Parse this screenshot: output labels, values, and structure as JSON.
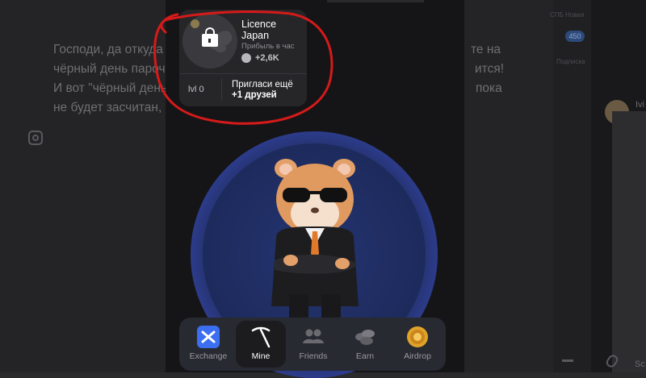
{
  "background_article": {
    "lines": [
      "Господи, да откуда и",
      "чёрный день парочк",
      "И вот \"чёрный день\"",
      "не будет засчитан, р"
    ],
    "right_fragments": [
      "те на",
      "ится!",
      "пока"
    ]
  },
  "right_sidebar": {
    "label_top": "СПБ Новая",
    "badge": "450",
    "label2": "Подписка",
    "label3": "Ivi",
    "label4": "Sc"
  },
  "card": {
    "title": "Licence Japan",
    "subtitle": "Прибыль в час",
    "profit": "+2,6K",
    "level": "lvl 0",
    "invite_line1": "Пригласи ещё",
    "invite_line2": "+1 друзей"
  },
  "nav": {
    "items": [
      {
        "label": "Exchange",
        "icon": "exchange-icon",
        "active": false
      },
      {
        "label": "Mine",
        "icon": "pickaxe-icon",
        "active": true
      },
      {
        "label": "Friends",
        "icon": "friends-icon",
        "active": false
      },
      {
        "label": "Earn",
        "icon": "coins-icon",
        "active": false
      },
      {
        "label": "Airdrop",
        "icon": "airdrop-coin-icon",
        "active": false
      }
    ]
  },
  "colors": {
    "annotation": "#d61a1a",
    "accent_blue": "#3b6ef0",
    "gold": "#e0a32a"
  }
}
